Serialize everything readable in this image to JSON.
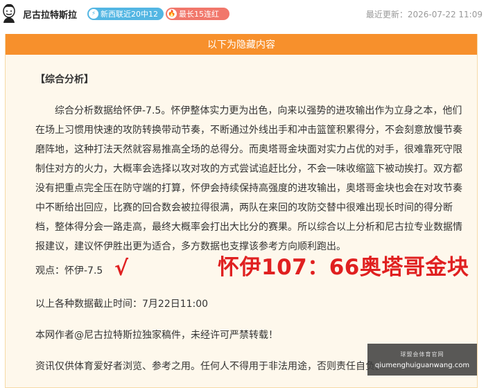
{
  "header": {
    "author": "尼古拉特斯拉",
    "badge_streak": "新西联近20中12",
    "badge_winning": "最长15连红",
    "updated": "最近更新：2026-07-22 11:09"
  },
  "panel": {
    "bar_title": "以下为隐藏内容",
    "section_title": "【综合分析】",
    "paragraph": "综合分析数据给怀伊-7.5。怀伊整体实力更为出色，向来以强势的进攻输出作为立身之本，他们在场上习惯用快速的攻防转换带动节奏，不断通过外线出手和冲击篮筐积累得分，不会刻意放慢节奏磨阵地，这种打法天然就容易推高全场的总得分。而奥塔哥金块面对实力占优的对手，很难靠死守限制住对方的火力，大概率会选择以攻对攻的方式尝试追赶比分，不会一味收缩篮下被动挨打。双方都没有把重点完全压在防守端的打算，怀伊会持续保持高强度的进攻输出，奥塔哥金块也会在对攻节奏中不断给出回应，比赛的回合数会被拉得很满，两队在来回的攻防交替中很难出现长时间的得分断档，整体得分会一路走高，最终大概率会打出大比分的赛果。所以综合以上分析和尼古拉专业数据情报建议，建议怀伊胜出更为适合，多方数据也支撑该参考方向顺利跑出。",
    "view": "观点：怀伊-7.5",
    "check_mark": "√",
    "result": "怀伊107：66奥塔哥金块",
    "cutoff": "以上各种数据截止时间：7月22日11:00",
    "copyright": "本网作者@尼古拉特斯拉独家稿件，未经许可严禁转载！",
    "disclaimer": "资讯仅供体育爱好者浏览、参考之用。任何人不得用于非法用途，否则责任自负。"
  },
  "watermark": {
    "top": "球盟会体育官网",
    "url": "qiumenghuiguanwang.com"
  },
  "colors": {
    "accent_orange": "#f7902c",
    "result_red": "#e02020",
    "badge_blue": "#53b6e3",
    "badge_red": "#f1776b"
  }
}
